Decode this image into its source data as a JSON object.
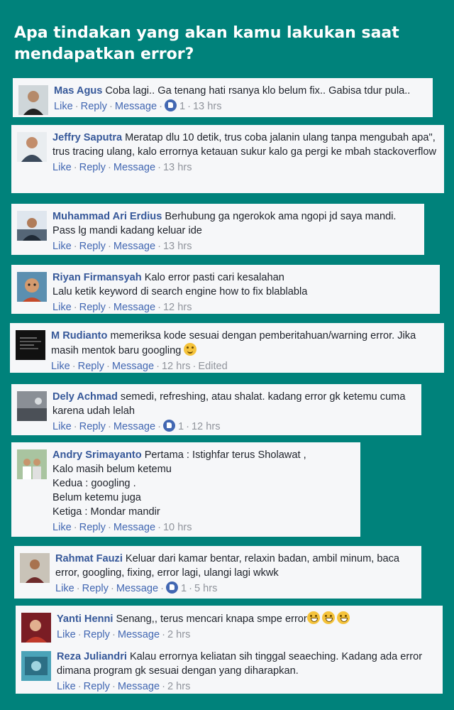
{
  "title": "Apa tindakan yang akan kamu lakukan saat mendapatkan error?",
  "actions": {
    "like": "Like",
    "reply": "Reply",
    "message": "Message"
  },
  "comments": [
    {
      "name": "Mas Agus",
      "text": "Coba lagi.. Ga tenang hati rsanya klo belum fix.. Gabisa tdur pula..",
      "likes": "1",
      "time": "13 hrs"
    },
    {
      "name": "Jeffry Saputra",
      "text": "Meratap dlu 10 detik, trus coba jalanin ulang tanpa mengubah apa\", trus tracing ulang, kalo errornya ketauan sukur kalo ga pergi ke mbah stackoverflow",
      "time": "13 hrs"
    },
    {
      "name": "Muhammad Ari Erdius",
      "text": "Berhubung ga ngerokok ama ngopi jd saya mandi. Pass lg mandi kadang keluar ide",
      "time": "13 hrs"
    },
    {
      "name": "Riyan Firmansyah",
      "text": "Kalo error pasti cari kesalahan",
      "text2": "Lalu ketik keyword di search engine how to fix blablabla",
      "time": "12 hrs"
    },
    {
      "name": "M Rudianto",
      "text": "memeriksa kode sesuai dengan pemberitahuan/warning error. Jika masih mentok baru googling",
      "time": "12 hrs",
      "edited": "Edited"
    },
    {
      "name": "Dely Achmad",
      "text": "semedi, refreshing, atau shalat. kadang error gk ketemu cuma karena udah lelah",
      "likes": "1",
      "time": "12 hrs"
    },
    {
      "name": "Andry Srimayanto",
      "text": "Pertama : Istighfar terus Sholawat ,",
      "lines": [
        "Kalo masih belum ketemu",
        "Kedua : googling .",
        "Belum ketemu juga",
        "Ketiga : Mondar mandir"
      ],
      "time": "10 hrs"
    },
    {
      "name": "Rahmat Fauzi",
      "text": "Keluar dari kamar bentar, relaxin badan, ambil minum, baca error, googling, fixing, error lagi, ulangi lagi wkwk",
      "likes": "1",
      "time": "5 hrs"
    },
    {
      "name": "Yanti Henni",
      "text": "Senang,, terus mencari knapa smpe error",
      "time": "2 hrs"
    },
    {
      "name": "Reza Juliandri",
      "text": "Kalau errornya keliatan sih tinggal seaeching. Kadang ada error dimana program gk sesuai dengan yang diharapkan.",
      "time": "2 hrs"
    }
  ],
  "colors": {
    "background": "#00827b",
    "card": "#f6f7f9",
    "name": "#365899",
    "link": "#4267b2",
    "muted": "#90949c"
  }
}
